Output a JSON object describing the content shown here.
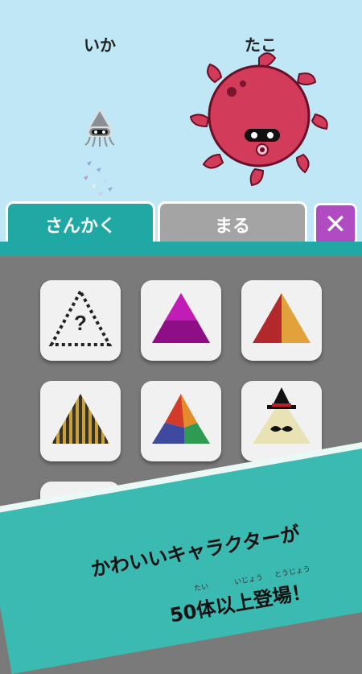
{
  "characters": {
    "left": {
      "name": "いか",
      "icon": "squid-icon"
    },
    "right": {
      "name": "たこ",
      "icon": "octopus-icon"
    }
  },
  "tabs": {
    "sankaku": "さんかく",
    "maru": "まる",
    "close": "✕"
  },
  "colors": {
    "teal": "#20a9a4",
    "tab_inactive": "#a4a4a4",
    "close": "#b04bc1",
    "sky": "#bfe7f5",
    "grid_bg": "#7a7a7a"
  },
  "items": [
    {
      "name": "unknown-triangle-icon",
      "label": "?"
    },
    {
      "name": "purple-triangle-icon"
    },
    {
      "name": "red-orange-triangle-icon"
    },
    {
      "name": "striped-triangle-icon"
    },
    {
      "name": "tricolor-triangle-icon"
    },
    {
      "name": "hat-mustache-triangle-icon"
    },
    {
      "name": "polka-dot-bow-triangle-icon"
    },
    {
      "name": "watermelon-triangle-icon"
    },
    {
      "name": "brown-triangle-icon"
    }
  ],
  "banner": {
    "line1": "かわいいキャラクターが",
    "line2": "50体以上登場！",
    "ruby": [
      "たい",
      "いじょう",
      "とうじょう"
    ]
  }
}
